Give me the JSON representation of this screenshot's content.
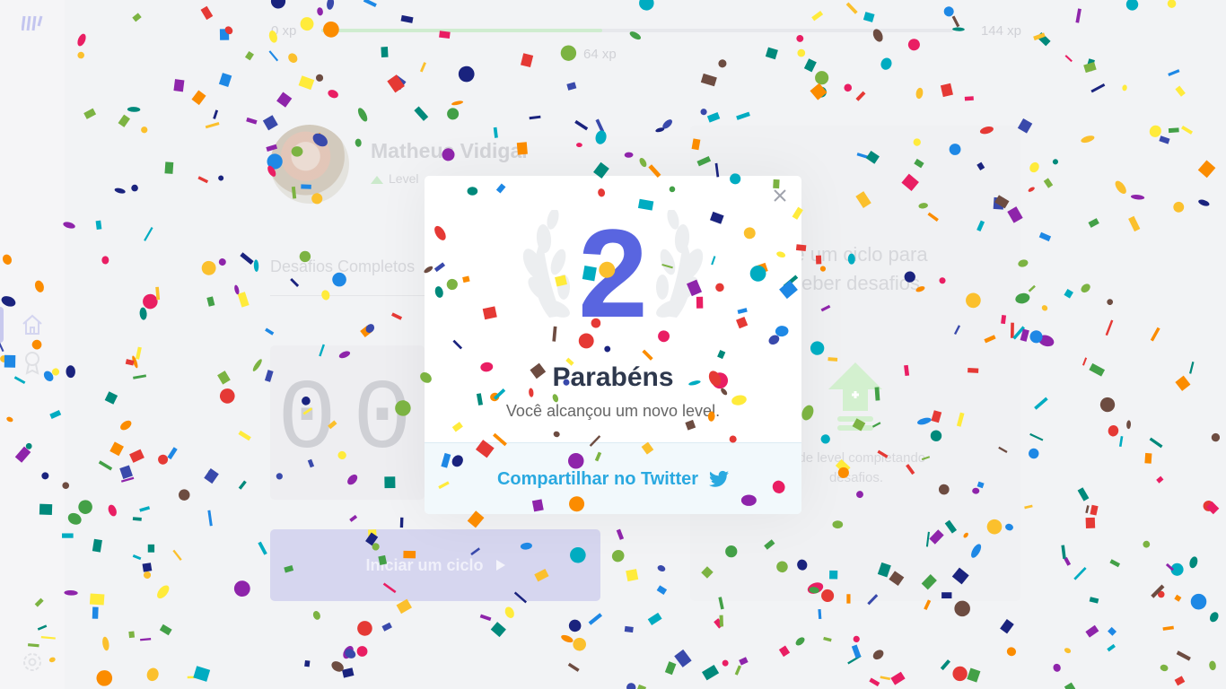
{
  "colors": {
    "accent": "#5965e0",
    "title": "#2e384d",
    "text": "#666666",
    "twitter": "#2aa9e0",
    "success": "#4cd62b",
    "background": "#f2f3f5",
    "modal_background": "#ffffff",
    "footer_background": "#f2f9fc"
  },
  "sidebar": {
    "items": [
      {
        "icon": "home-icon",
        "active": true
      },
      {
        "icon": "award-icon",
        "active": false
      },
      {
        "icon": "gear-icon",
        "active": false
      }
    ]
  },
  "experience": {
    "min_label": "0 xp",
    "max_label": "144 xp",
    "current_label": "64 xp",
    "progress_fraction": 0.444
  },
  "profile": {
    "name": "Matheus Vidigal",
    "level_label": "Level"
  },
  "challenges": {
    "label": "Desafios Completos"
  },
  "countdown": {
    "minutes": [
      "0",
      "0"
    ]
  },
  "cycle_button": {
    "label": "Iniciar um ciclo"
  },
  "challenge_card": {
    "text": "Finalize um ciclo para receber desafios",
    "visible_text": "e um ciclo para\neber desafios",
    "hint": "Avance de level completando desafios.",
    "visible_hint": "e de level completando\ndesafios."
  },
  "modal": {
    "level": "2",
    "title": "Parabéns",
    "subtitle": "Você alcançou um novo level.",
    "share_label": "Compartilhar no Twitter"
  }
}
